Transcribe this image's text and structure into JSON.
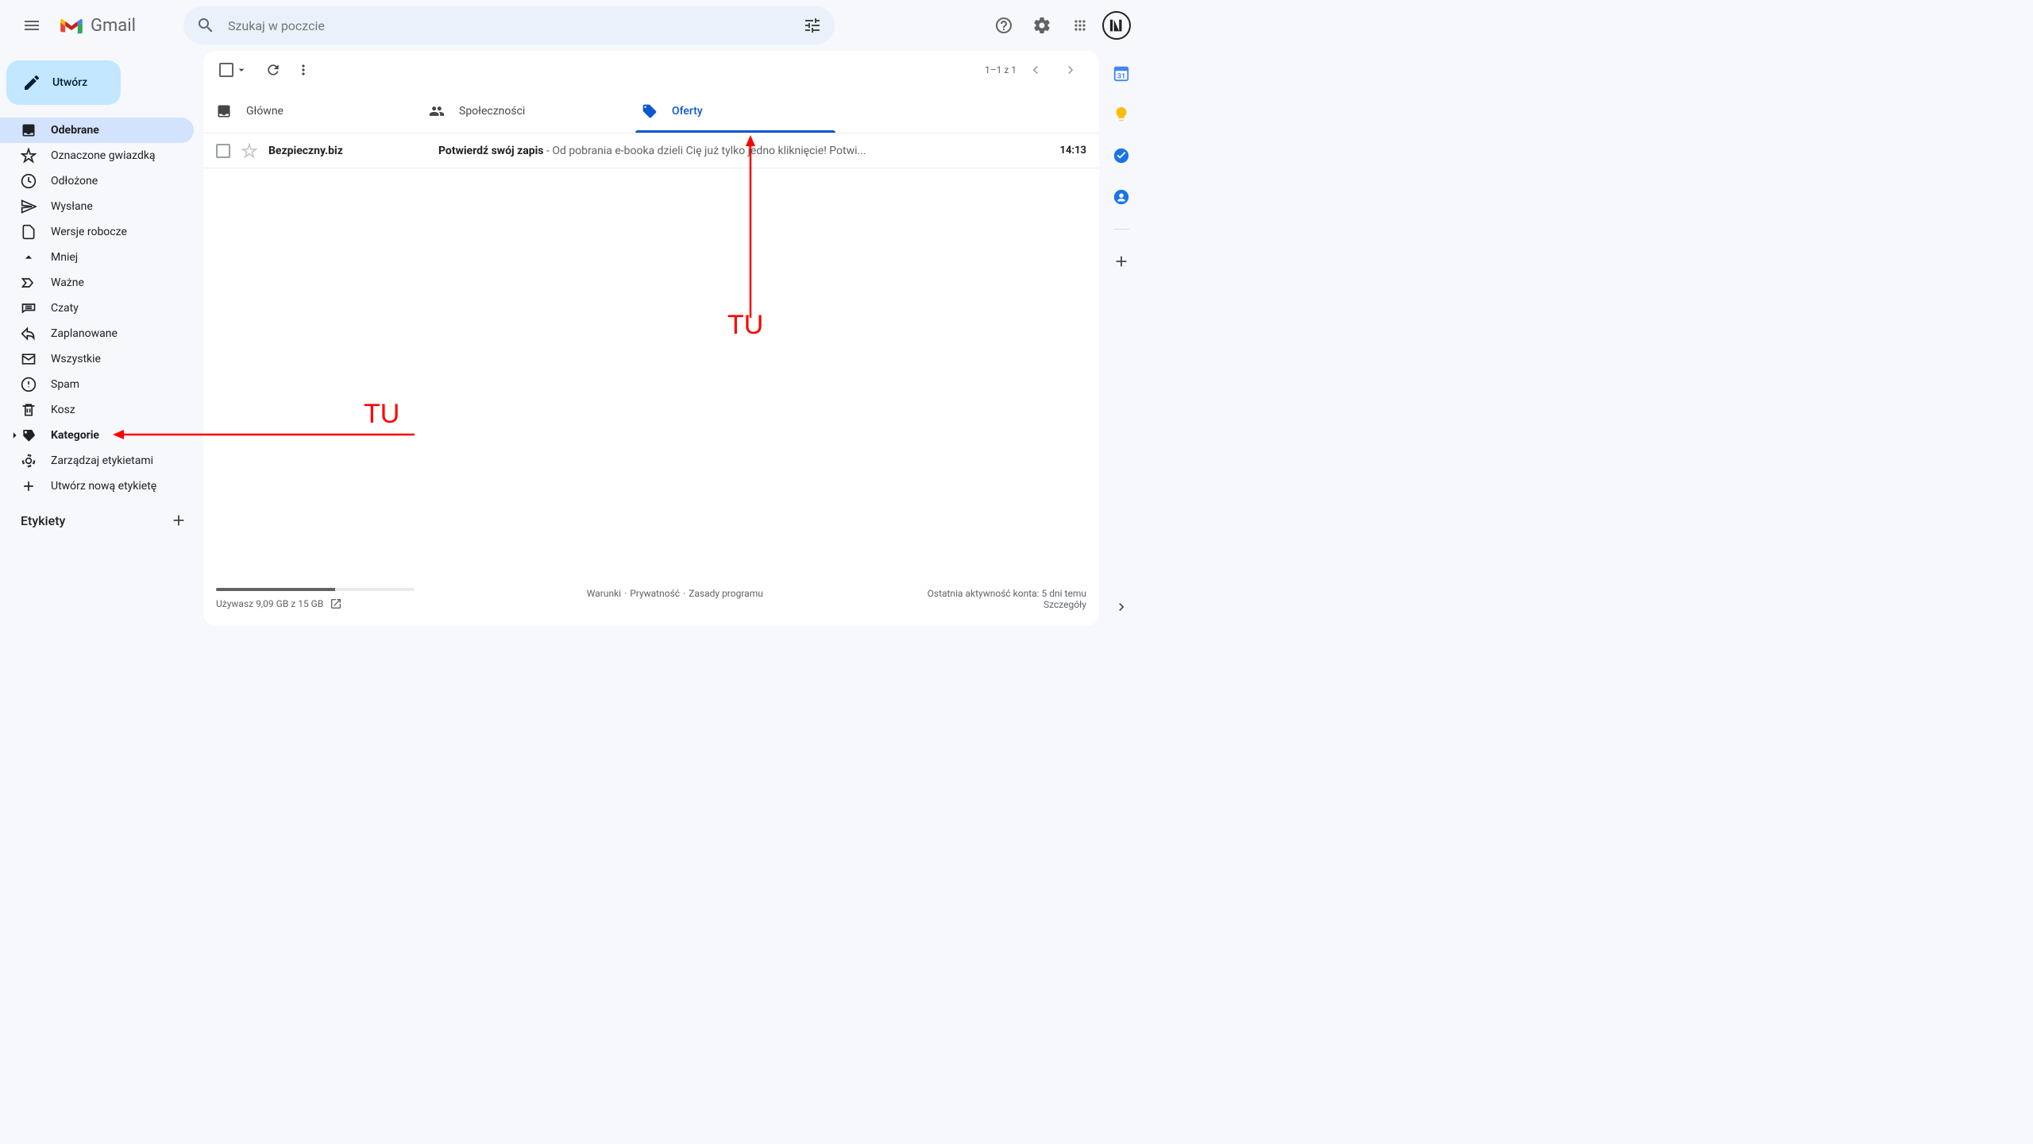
{
  "header": {
    "logo_text": "Gmail",
    "search_placeholder": "Szukaj w poczcie"
  },
  "compose": {
    "label": "Utwórz"
  },
  "sidebar": {
    "items": [
      {
        "label": "Odebrane"
      },
      {
        "label": "Oznaczone gwiazdką"
      },
      {
        "label": "Odłożone"
      },
      {
        "label": "Wysłane"
      },
      {
        "label": "Wersje robocze"
      },
      {
        "label": "Mniej"
      },
      {
        "label": "Ważne"
      },
      {
        "label": "Czaty"
      },
      {
        "label": "Zaplanowane"
      },
      {
        "label": "Wszystkie"
      },
      {
        "label": "Spam"
      },
      {
        "label": "Kosz"
      },
      {
        "label": "Kategorie"
      },
      {
        "label": "Zarządzaj etykietami"
      },
      {
        "label": "Utwórz nową etykietę"
      }
    ],
    "labels_header": "Etykiety"
  },
  "toolbar": {
    "pagination": "1–1 z 1"
  },
  "tabs": [
    {
      "label": "Główne"
    },
    {
      "label": "Społeczności"
    },
    {
      "label": "Oferty"
    }
  ],
  "emails": [
    {
      "sender": "Bezpieczny.biz",
      "subject": "Potwierdź swój zapis",
      "preview": " - Od pobrania e-booka dzieli Cię już tylko jedno kliknięcie! Potwi...",
      "time": "14:13"
    }
  ],
  "footer": {
    "storage_used": "Używasz 9,09 GB z 15 GB",
    "storage_percent": 60,
    "links": {
      "terms": "Warunki",
      "privacy": "Prywatność",
      "policies": "Zasady programu"
    },
    "activity": "Ostatnia aktywność konta: 5 dni temu",
    "details": "Szczegóły"
  },
  "annotations": {
    "a1": "TU",
    "a2": "TU"
  }
}
